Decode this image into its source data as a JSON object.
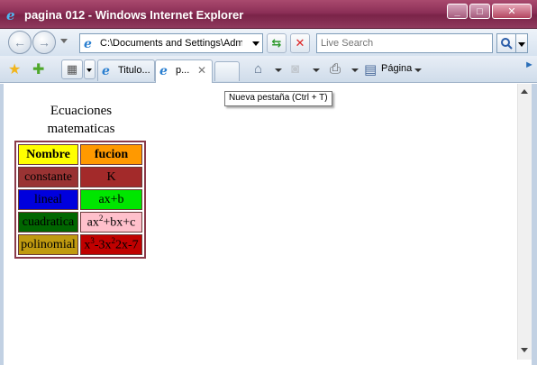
{
  "window": {
    "title": "pagina 012 - Windows Internet Explorer",
    "colors": {
      "titlebar": "#8c2f57"
    }
  },
  "toolbar": {
    "address": "C:\\Documents and Settings\\Admir",
    "search_placeholder": "Live Search"
  },
  "tabs": [
    {
      "label": "Titulo..."
    },
    {
      "label": "p..."
    }
  ],
  "command_bar": {
    "page_label": "Página"
  },
  "tooltip": "Nueva pestaña (Ctrl + T)",
  "page": {
    "heading_line1": "Ecuaciones",
    "heading_line2": "matematicas",
    "table": {
      "headers": [
        {
          "text": "Nombre",
          "bg": "#ffff00",
          "fg": "#000000"
        },
        {
          "text": "fucion",
          "bg": "#ff9900",
          "fg": "#000000"
        }
      ],
      "rows": [
        {
          "name": "constante",
          "name_bg": "#993333",
          "name_fg": "#000000",
          "formula_bg": "#a32a2a",
          "formula_fg": "#000000",
          "formula": [
            {
              "t": "K"
            }
          ]
        },
        {
          "name": "lineal",
          "name_bg": "#0000dd",
          "name_fg": "#000000",
          "formula_bg": "#00e600",
          "formula_fg": "#000000",
          "formula": [
            {
              "t": "ax+b"
            }
          ]
        },
        {
          "name": "cuadratica",
          "name_bg": "#006600",
          "name_fg": "#000000",
          "formula_bg": "#ffc0cb",
          "formula_fg": "#000000",
          "formula": [
            {
              "t": "ax"
            },
            {
              "sup": "2"
            },
            {
              "t": "+bx+c"
            }
          ]
        },
        {
          "name": "polinomial",
          "name_bg": "#c09a10",
          "name_fg": "#000000",
          "formula_bg": "#c00000",
          "formula_fg": "#000000",
          "formula": [
            {
              "t": "x"
            },
            {
              "sup": "3"
            },
            {
              "t": "-3x"
            },
            {
              "sup": "2"
            },
            {
              "t": "2x-7"
            }
          ]
        }
      ]
    }
  }
}
